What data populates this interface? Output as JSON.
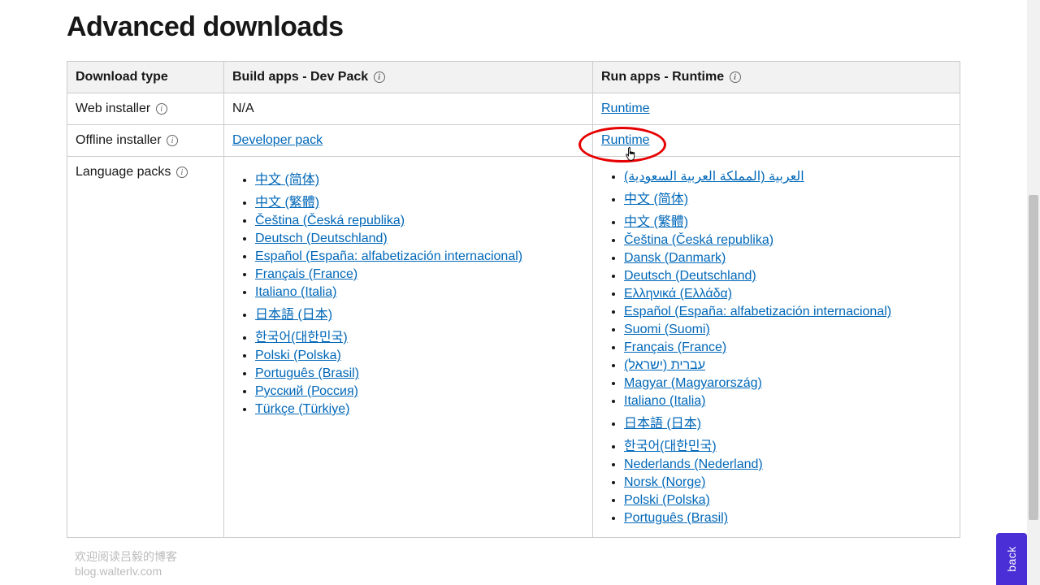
{
  "heading": "Advanced downloads",
  "table": {
    "headers": {
      "col1": "Download type",
      "col2": "Build apps - Dev Pack",
      "col3": "Run apps - Runtime"
    },
    "rows": {
      "web": {
        "label": "Web installer",
        "dev": "N/A",
        "runtime_link": "Runtime"
      },
      "offline": {
        "label": "Offline installer",
        "dev_link": "Developer pack",
        "runtime_link": "Runtime"
      },
      "lang": {
        "label": "Language packs",
        "dev_list": [
          "中文 (简体)",
          "中文 (繁體)",
          "Čeština (Česká republika)",
          "Deutsch (Deutschland)",
          "Español (España: alfabetización internacional)",
          "Français (France)",
          "Italiano (Italia)",
          "日本語 (日本)",
          "한국어(대한민국)",
          "Polski (Polska)",
          "Português (Brasil)",
          "Русский (Россия)",
          "Türkçe (Türkiye)"
        ],
        "runtime_list": [
          "العربية (المملكة العربية السعودية)",
          "中文 (简体)",
          "中文 (繁體)",
          "Čeština (Česká republika)",
          "Dansk (Danmark)",
          "Deutsch (Deutschland)",
          "Ελληνικά (Ελλάδα)",
          "Español (España: alfabetización internacional)",
          "Suomi (Suomi)",
          "Français (France)",
          "עברית (ישראל)",
          "Magyar (Magyarország)",
          "Italiano (Italia)",
          "日本語 (日本)",
          "한국어(대한민국)",
          "Nederlands (Nederland)",
          "Norsk (Norge)",
          "Polski (Polska)",
          "Português (Brasil)"
        ]
      }
    }
  },
  "watermark": {
    "line1": "欢迎阅读吕毅的博客",
    "line2": "blog.walterlv.com"
  },
  "feedback_label": "back"
}
